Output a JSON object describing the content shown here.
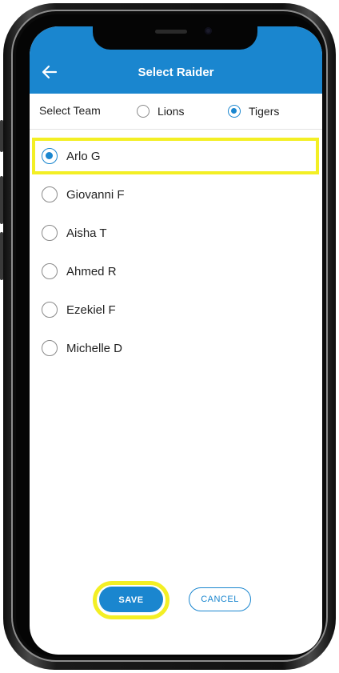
{
  "app_bar": {
    "title": "Select Raider",
    "back_icon": "back-arrow-icon",
    "color": "#1a86cf"
  },
  "team_select": {
    "label": "Select Team",
    "options": [
      {
        "label": "Lions",
        "selected": false
      },
      {
        "label": "Tigers",
        "selected": true
      }
    ]
  },
  "raiders": [
    {
      "name": "Arlo G",
      "selected": true
    },
    {
      "name": "Giovanni F",
      "selected": false
    },
    {
      "name": "Aisha T",
      "selected": false
    },
    {
      "name": "Ahmed R",
      "selected": false
    },
    {
      "name": "Ezekiel F",
      "selected": false
    },
    {
      "name": "Michelle D",
      "selected": false
    }
  ],
  "buttons": {
    "save_label": "SAVE",
    "cancel_label": "CANCEL"
  },
  "highlight_color": "#f3ef24"
}
